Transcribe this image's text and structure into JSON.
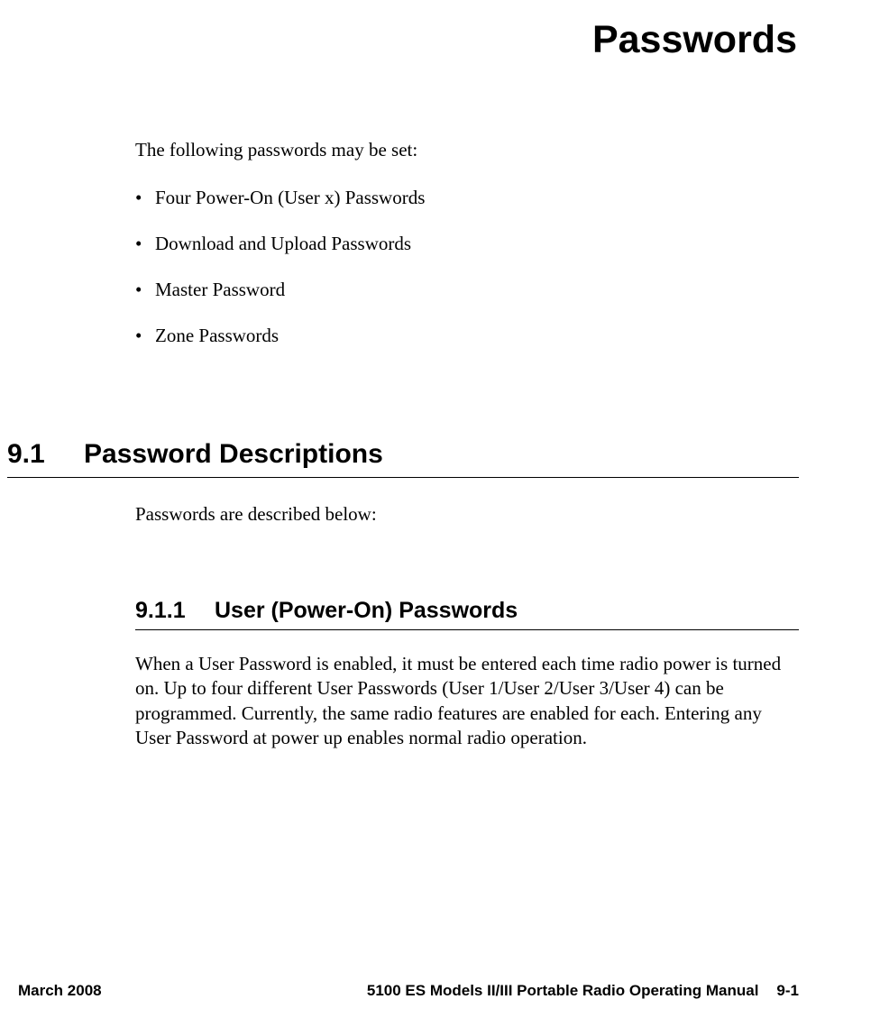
{
  "chapter": {
    "title": "Passwords"
  },
  "intro": "The following passwords may be set:",
  "bullets": [
    "Four Power-On (User x) Passwords",
    "Download and Upload Passwords",
    "Master Password",
    "Zone Passwords"
  ],
  "section": {
    "number": "9.1",
    "title": "Password Descriptions",
    "intro": "Passwords are described below:"
  },
  "subsection": {
    "number": "9.1.1",
    "title": "User (Power-On) Passwords",
    "body": "When a User Password is enabled, it must be entered each time radio power is turned on. Up to four different User Passwords (User 1/User 2/User 3/User 4) can be programmed. Currently, the same radio features are enabled for each. Entering any User Password at power up enables normal radio operation."
  },
  "footer": {
    "date": "March 2008",
    "manual": "5100 ES Models II/III Portable Radio Operating Manual",
    "page": "9-1"
  }
}
